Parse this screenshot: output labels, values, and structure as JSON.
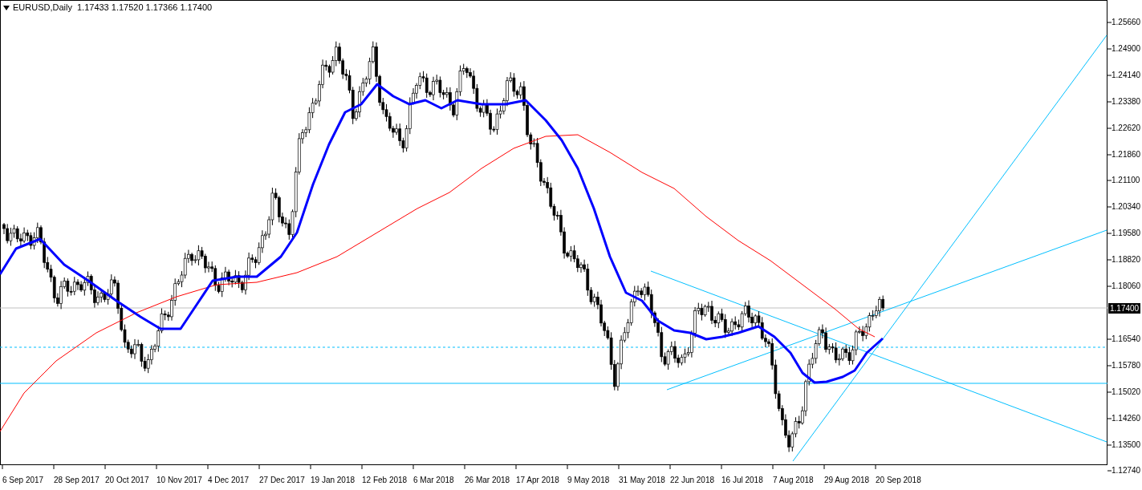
{
  "header": {
    "symbol": "EURUSD,Daily",
    "ohlc": "1.17433 1.17520 1.17366 1.17400"
  },
  "price_axis": [
    "1.25660",
    "1.24900",
    "1.24140",
    "1.23380",
    "1.22620",
    "1.21860",
    "1.21100",
    "1.20340",
    "1.19580",
    "1.18820",
    "1.18060",
    "1.16540",
    "1.15780",
    "1.15020",
    "1.14260",
    "1.13500",
    "1.12740"
  ],
  "current_price": "1.17400",
  "time_axis": [
    "6 Sep 2017",
    "28 Sep 2017",
    "20 Oct 2017",
    "10 Nov 2017",
    "4 Dec 2017",
    "27 Dec 2017",
    "19 Jan 2018",
    "12 Feb 2018",
    "6 Mar 2018",
    "26 Mar 2018",
    "17 Apr 2018",
    "9 May 2018",
    "31 May 2018",
    "22 Jun 2018",
    "16 Jul 2018",
    "7 Aug 2018",
    "29 Aug 2018",
    "20 Sep 2018"
  ]
}
